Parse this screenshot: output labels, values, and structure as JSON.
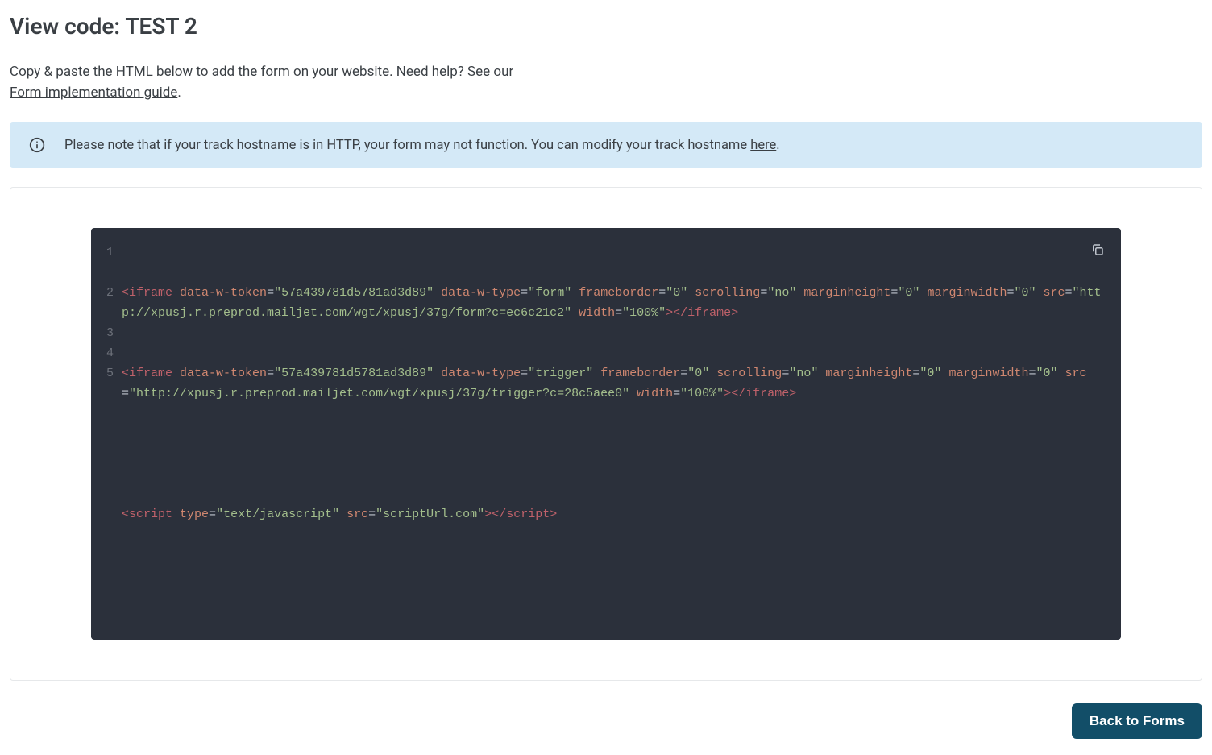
{
  "header": {
    "title": "View code: TEST 2"
  },
  "intro": {
    "text_before_link": "Copy & paste the HTML below to add the form on your website. Need help? See our ",
    "link_text": "Form implementation guide",
    "text_after_link": "."
  },
  "alert": {
    "text_before_link": "Please note that if your track hostname is in HTTP, your form may not function. You can modify your track hostname ",
    "link_text": "here",
    "text_after_link": "."
  },
  "code": {
    "line_numbers": [
      "1",
      "2",
      "3",
      "4",
      "5"
    ],
    "lines": {
      "l1": {
        "tag_open": "<iframe",
        "attrs": [
          {
            "name": "data-w-token",
            "eq": "=",
            "val": "\"57a439781d5781ad3d89\""
          },
          {
            "name": "data-w-type",
            "eq": "=",
            "val": "\"form\""
          },
          {
            "name": "frameborder",
            "eq": "=",
            "val": "\"0\""
          },
          {
            "name": "scrolling",
            "eq": "=",
            "val": "\"no\""
          },
          {
            "name": "marginheight",
            "eq": "=",
            "val": "\"0\""
          },
          {
            "name": "marginwidth",
            "eq": "=",
            "val": "\"0\""
          },
          {
            "name": "src",
            "eq": "=",
            "val": "\"http://xpusj.r.preprod.mailjet.com/wgt/xpusj/37g/form?c=ec6c21c2\""
          },
          {
            "name": "width",
            "eq": "=",
            "val": "\"100%\""
          }
        ],
        "tag_end": ">",
        "close": "</iframe>"
      },
      "l2": {
        "tag_open": "<iframe",
        "attrs": [
          {
            "name": "data-w-token",
            "eq": "=",
            "val": "\"57a439781d5781ad3d89\""
          },
          {
            "name": "data-w-type",
            "eq": "=",
            "val": "\"trigger\""
          },
          {
            "name": "frameborder",
            "eq": "=",
            "val": "\"0\""
          },
          {
            "name": "scrolling",
            "eq": "=",
            "val": "\"no\""
          },
          {
            "name": "marginheight",
            "eq": "=",
            "val": "\"0\""
          },
          {
            "name": "marginwidth",
            "eq": "=",
            "val": "\"0\""
          },
          {
            "name": "src",
            "eq": "=",
            "val": "\"http://xpusj.r.preprod.mailjet.com/wgt/xpusj/37g/trigger?c=28c5aee0\""
          },
          {
            "name": "width",
            "eq": "=",
            "val": "\"100%\""
          }
        ],
        "tag_end": ">",
        "close": "</iframe>"
      },
      "l3": "",
      "l4": {
        "tag_open": "<script",
        "attrs": [
          {
            "name": "type",
            "eq": "=",
            "val": "\"text/javascript\""
          },
          {
            "name": "src",
            "eq": "=",
            "val": "\"scriptUrl.com\""
          }
        ],
        "tag_end": ">",
        "close_script_name": "script"
      },
      "l5": ""
    }
  },
  "footer": {
    "back_label": "Back to Forms"
  }
}
